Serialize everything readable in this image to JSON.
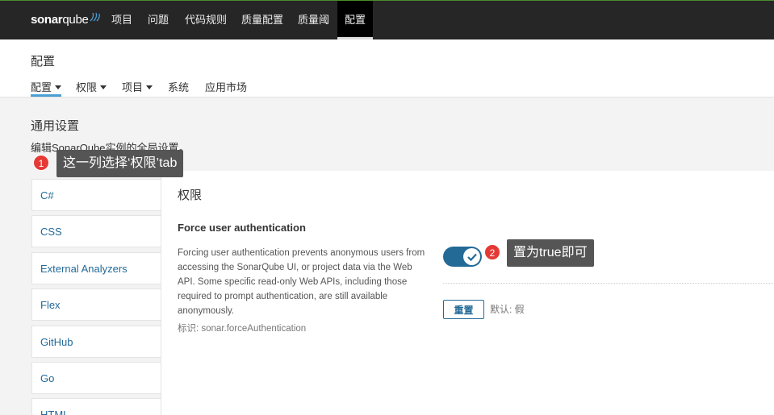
{
  "topnav": {
    "logo_main": "sonar",
    "logo_q": "qube",
    "items": [
      "项目",
      "问题",
      "代码规则",
      "质量配置",
      "质量阈",
      "配置"
    ]
  },
  "header": {
    "title": "配置",
    "tabs": [
      "配置",
      "权限",
      "项目",
      "系统",
      "应用市场"
    ]
  },
  "section": {
    "title": "通用设置",
    "description": "编辑SonarQube实例的全局设置。"
  },
  "categories": [
    "C#",
    "CSS",
    "External Analyzers",
    "Flex",
    "GitHub",
    "Go",
    "HTML"
  ],
  "panel": {
    "title": "权限",
    "setting_name": "Force user authentication",
    "setting_desc": "Forcing user authentication prevents anonymous users from accessing the SonarQube UI, or project data via the Web API. Some specific read-only Web APIs, including those required to prompt authentication, are still available anonymously.",
    "setting_key": "标识: sonar.forceAuthentication",
    "toggle_state": true,
    "reset_label": "重置",
    "default_label": "默认: 假"
  },
  "annotations": {
    "badge1": "1",
    "tip1": "这一列选择‘权限’tab",
    "badge2": "2",
    "tip2": "置为true即可"
  },
  "colors": {
    "accent": "#236a97",
    "badge": "#e53935",
    "topnav": "#262626"
  }
}
